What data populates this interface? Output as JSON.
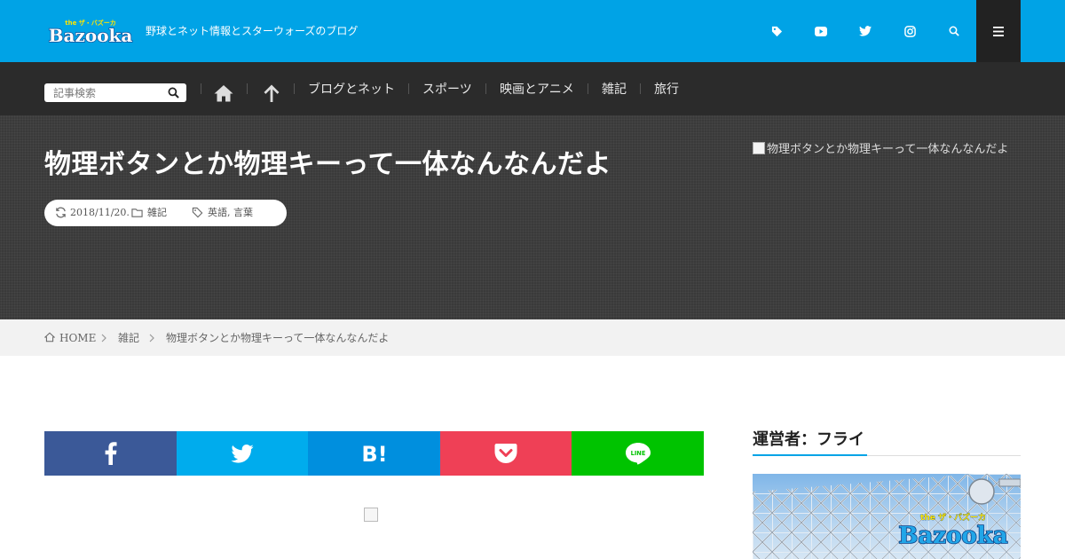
{
  "header": {
    "logo_text": "Bazooka",
    "tagline": "野球とネット情報とスターウォーズのブログ",
    "icons": [
      "tag-icon",
      "youtube-icon",
      "twitter-icon",
      "instagram-icon",
      "search-icon",
      "menu-icon"
    ],
    "accent_color": "#00a3e6"
  },
  "nav": {
    "search_placeholder": "記事検索",
    "links": [
      "ブログとネット",
      "スポーツ",
      "映画とアニメ",
      "雑記",
      "旅行"
    ]
  },
  "article": {
    "title": "物理ボタンとか物理キーって一体なんなんだよ",
    "date": "2018/11/20.",
    "category": "雑記",
    "tags": "英語,  言葉",
    "hero_image_alt": "物理ボタンとか物理キーって一体なんなんだよ"
  },
  "breadcrumb": {
    "home": "HOME",
    "category": "雑記",
    "current": "物理ボタンとか物理キーって一体なんなんだよ"
  },
  "share": {
    "buttons": [
      {
        "name": "facebook",
        "label": "f",
        "color": "#3b5998"
      },
      {
        "name": "twitter",
        "label": "",
        "color": "#00aced"
      },
      {
        "name": "hatena",
        "label": "B!",
        "color": "#008fde"
      },
      {
        "name": "pocket",
        "label": "",
        "color": "#ef4056"
      },
      {
        "name": "line",
        "label": "LINE",
        "color": "#00c300"
      }
    ]
  },
  "sidebar": {
    "title": "運営者：フライ",
    "image_logo_text": "Bazooka"
  }
}
